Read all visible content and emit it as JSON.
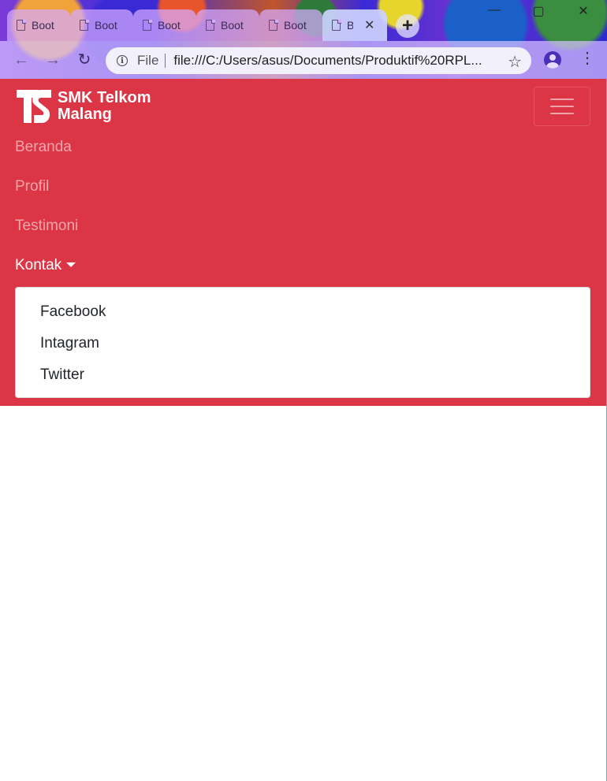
{
  "browser": {
    "tabs": [
      {
        "title": "Boot",
        "active": false
      },
      {
        "title": "Boot",
        "active": false
      },
      {
        "title": "Boot",
        "active": false
      },
      {
        "title": "Boot",
        "active": false
      },
      {
        "title": "Boot",
        "active": false
      },
      {
        "title": "B",
        "active": true
      }
    ],
    "active_tab_close": "✕",
    "new_tab": "+",
    "window_controls": {
      "minimize": "—",
      "maximize": "▢",
      "close": "✕"
    },
    "back": "←",
    "forward": "→",
    "reload": "↻",
    "site_info": "i",
    "scheme_label": "File",
    "url": "file:///C:/Users/asus/Documents/Produktif%20RPL...",
    "bookmark": "☆",
    "menu": "⋮"
  },
  "navbar": {
    "brand_line1": "SMK Telkom",
    "brand_line2": "Malang",
    "links": [
      {
        "label": "Beranda"
      },
      {
        "label": "Profil"
      },
      {
        "label": "Testimoni"
      },
      {
        "label": "Kontak"
      }
    ],
    "dropdown": [
      {
        "label": "Facebook"
      },
      {
        "label": "Intagram"
      },
      {
        "label": "Twitter"
      }
    ]
  },
  "colors": {
    "navbar_bg": "#dc3545",
    "brand_text": "#ffffff",
    "link_muted": "rgba(255,255,255,0.55)",
    "link_active": "#ffffff"
  },
  "icons": [
    "file-icon",
    "close-icon",
    "plus-icon",
    "back-arrow-icon",
    "forward-arrow-icon",
    "reload-icon",
    "info-icon",
    "star-icon",
    "profile-icon",
    "kebab-menu-icon",
    "hamburger-icon",
    "caret-down-icon",
    "telkom-logo-icon"
  ]
}
